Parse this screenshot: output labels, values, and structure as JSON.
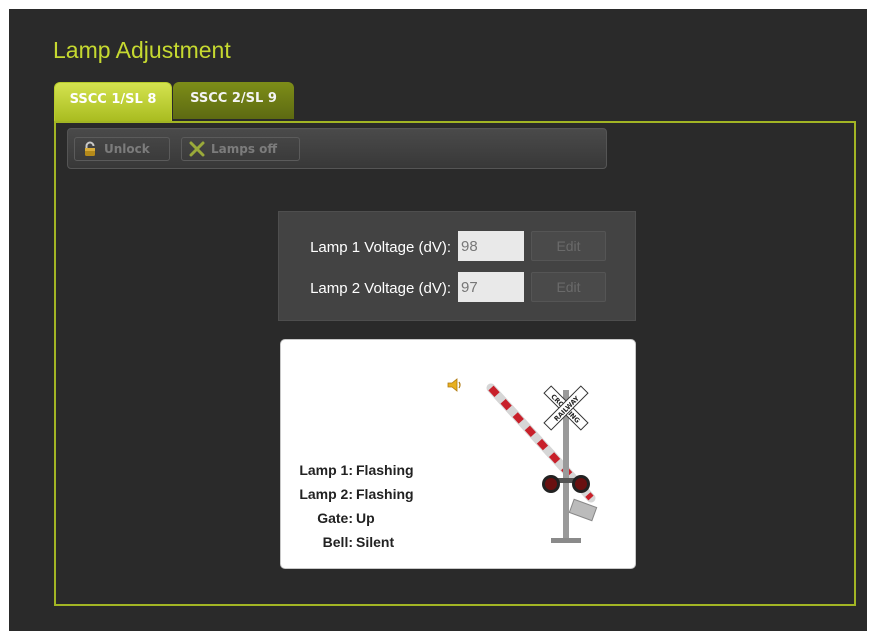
{
  "page": {
    "title": "Lamp Adjustment"
  },
  "tabs": [
    {
      "label": "SSCC 1/SL 8",
      "active": true
    },
    {
      "label": "SSCC 2/SL 9",
      "active": false
    }
  ],
  "toolbar": {
    "unlock_label": "Unlock",
    "unlock_icon": "lock-icon",
    "lamps_off_label": "Lamps off",
    "lamps_off_icon": "x-icon"
  },
  "voltages": [
    {
      "label": "Lamp 1 Voltage (dV):",
      "value": "98",
      "edit_label": "Edit"
    },
    {
      "label": "Lamp 2 Voltage (dV):",
      "value": "97",
      "edit_label": "Edit"
    }
  ],
  "status": {
    "speaker_icon": "speaker-icon",
    "rows": [
      {
        "key": "Lamp 1:",
        "value": "Flashing"
      },
      {
        "key": "Lamp 2:",
        "value": "Flashing"
      },
      {
        "key": "Gate:",
        "value": "Up"
      },
      {
        "key": "Bell:",
        "value": "Silent"
      }
    ]
  },
  "crossing_sign_text": [
    "RAILWAY",
    "CROSSING"
  ],
  "colors": {
    "accent": "#c6d930",
    "tab_active": "#b9cc2c",
    "tab_inactive": "#6e7c15",
    "background": "#2a2a2a",
    "panel_border": "#a2b524"
  }
}
